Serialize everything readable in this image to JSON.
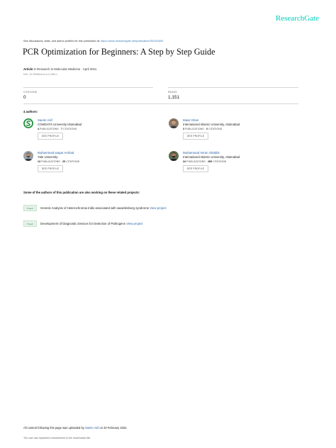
{
  "brand": "ResearchGate",
  "discussion_text": "See discussions, stats, and author profiles for this publication at:",
  "discussion_link": "https://www.researchgate.net/publication/351541690",
  "title": "PCR Optimization for Beginners: A Step by Step Guide",
  "meta": {
    "type": "Article",
    "in_label": "in",
    "journal": "Research in Molecular Medicine",
    "separator": "·",
    "date": "April 2021"
  },
  "doi": "DOI: 10.32598/rmm.9.2.1189.1",
  "stats": {
    "citations_label": "CITATIONS",
    "citations_value": "0",
    "reads_label": "READS",
    "reads_value": "1,151"
  },
  "authors_heading": "4 authors:",
  "authors": [
    {
      "name": "Saeim Asif",
      "affiliation": "COMSATS University Islamabad",
      "publications_count": "4",
      "publications_label": "PUBLICATIONS",
      "citations_count": "7",
      "citations_label": "CITATIONS",
      "button": "SEE PROFILE",
      "avatar_icon": "comsats-logo-icon"
    },
    {
      "name": "Maaz Khan",
      "affiliation": "International Islamic University, Islamabad",
      "publications_count": "3",
      "publications_label": "PUBLICATIONS",
      "citations_count": "0",
      "citations_label": "CITATIONS",
      "button": "SEE PROFILE",
      "avatar_icon": "profile-photo-icon"
    },
    {
      "name": "Muhammad waqar Arshad",
      "affiliation": "Yale University",
      "publications_count": "13",
      "publications_label": "PUBLICATIONS",
      "citations_count": "25",
      "citations_label": "CITATIONS",
      "button": "SEE PROFILE",
      "avatar_icon": "profile-photo-icon"
    },
    {
      "name": "Muhammad Imran Shabbir",
      "affiliation": "International Islamic University, Islamabad",
      "publications_count": "34",
      "publications_label": "PUBLICATIONS",
      "citations_count": "265",
      "citations_label": "CITATIONS",
      "button": "SEE PROFILE",
      "avatar_icon": "profile-photo-icon"
    }
  ],
  "related_heading": "Some of the authors of this publication are also working on these related projects:",
  "projects": [
    {
      "badge": "Project",
      "text": "Genetic Analysis of Heterochromia Iridis associated with waardenberg syndrome",
      "link": "View project"
    },
    {
      "badge": "Project",
      "text": "Development of Diagnostic Devices for Detection of Pathogens",
      "link": "View project"
    }
  ],
  "footer": {
    "uploaded_prefix": "All content following this page was uploaded by",
    "uploaded_by": "Saeim Asif",
    "uploaded_on": "on 20 February 2022.",
    "note": "The user has requested enhancement of the downloaded file."
  },
  "colors": {
    "brand": "#00ccbb",
    "link": "#2a64a8",
    "title": "#111111",
    "rule": "#d6d6d6"
  }
}
